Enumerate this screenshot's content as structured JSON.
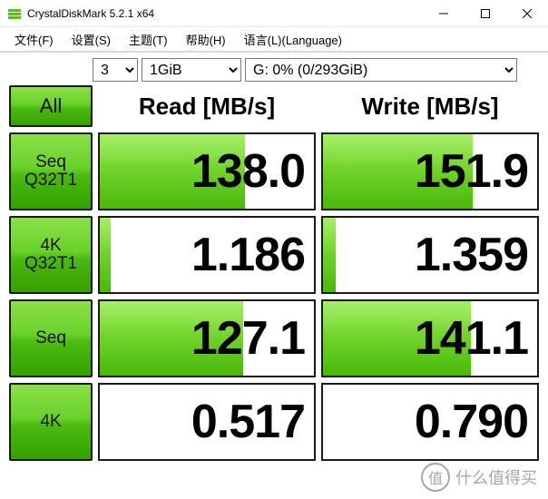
{
  "window": {
    "title": "CrystalDiskMark 5.2.1 x64"
  },
  "menu": {
    "file": "文件(F)",
    "settings": "设置(S)",
    "theme": "主题(T)",
    "help": "帮助(H)",
    "language": "语言(L)(Language)"
  },
  "controls": {
    "count": "3",
    "size": "1GiB",
    "drive": "G: 0% (0/293GiB)"
  },
  "headers": {
    "read": "Read [MB/s]",
    "write": "Write [MB/s]"
  },
  "buttons": {
    "all": "All",
    "seqQ32T1_l1": "Seq",
    "seqQ32T1_l2": "Q32T1",
    "fourKQ32T1_l1": "4K",
    "fourKQ32T1_l2": "Q32T1",
    "seq": "Seq",
    "fourK": "4K"
  },
  "results": {
    "seqQ32T1": {
      "read": "138.0",
      "write": "151.9",
      "readBar": "68%",
      "writeBar": "70%"
    },
    "fourKQ32T1": {
      "read": "1.186",
      "write": "1.359",
      "readBar": "5%",
      "writeBar": "6%"
    },
    "seq": {
      "read": "127.1",
      "write": "141.1",
      "readBar": "67%",
      "writeBar": "69%"
    },
    "fourK": {
      "read": "0.517",
      "write": "0.790",
      "readBar": "0%",
      "writeBar": "0%"
    }
  },
  "watermark": {
    "circle": "值",
    "text": "什么值得买"
  }
}
